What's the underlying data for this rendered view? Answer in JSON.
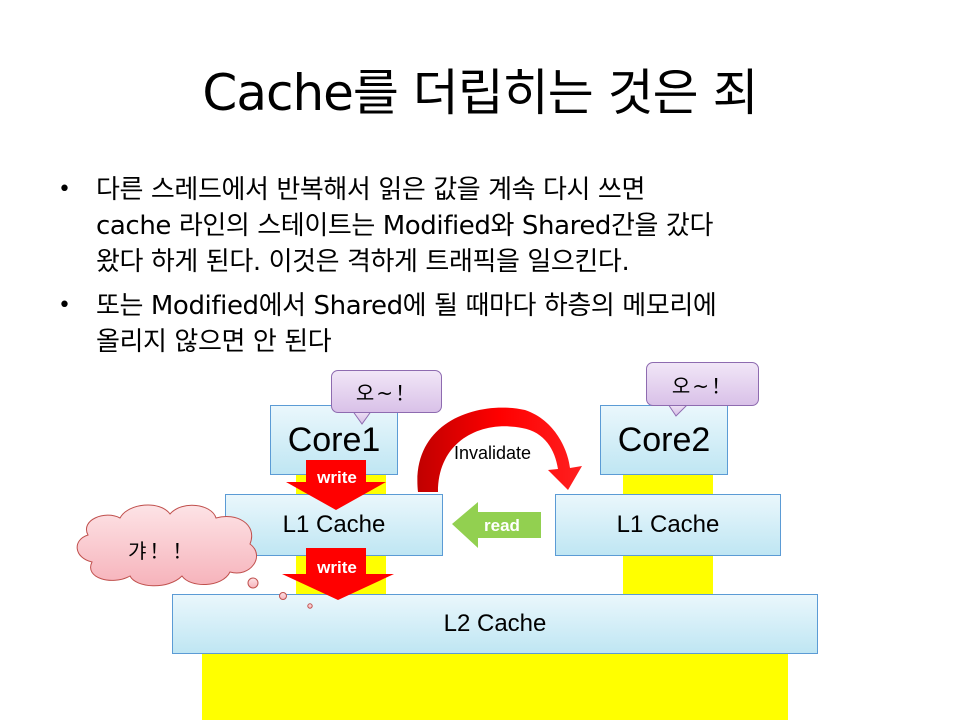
{
  "slide": {
    "title": "Cache를 더립히는 것은 죄",
    "bullets": [
      {
        "marker": "•",
        "text": "다른 스레드에서 반복해서 읽은 값을 계속 다시 쓰면\ncache 라인의 스테이트는 Modified와 Shared간을 갔다\n왔다 하게 된다. 이것은 격하게 트래픽을 일으킨다."
      },
      {
        "marker": "•",
        "text": "또는 Modified에서 Shared에 될 때마다 하층의 메모리에\n올리지 않으면 안 된다"
      }
    ]
  },
  "diagram": {
    "core1": "Core1",
    "core2": "Core2",
    "l1_left": "L1 Cache",
    "l1_right": "L1 Cache",
    "l2": "L2 Cache",
    "bubble_core1": "오~！",
    "bubble_core2": "오~！",
    "cloud_text": "갸！！",
    "write_top": "write",
    "write_bottom": "write",
    "read_label": "read",
    "invalidate_label": "Invalidate",
    "colors": {
      "memory_fill": "#ffff00",
      "cache_border": "#5b9bd5",
      "write_arrow": "#ff0000",
      "read_arrow": "#92d050",
      "callout_fill": "#dcc5ea",
      "cloud_fill": "#f9c6cc"
    }
  }
}
